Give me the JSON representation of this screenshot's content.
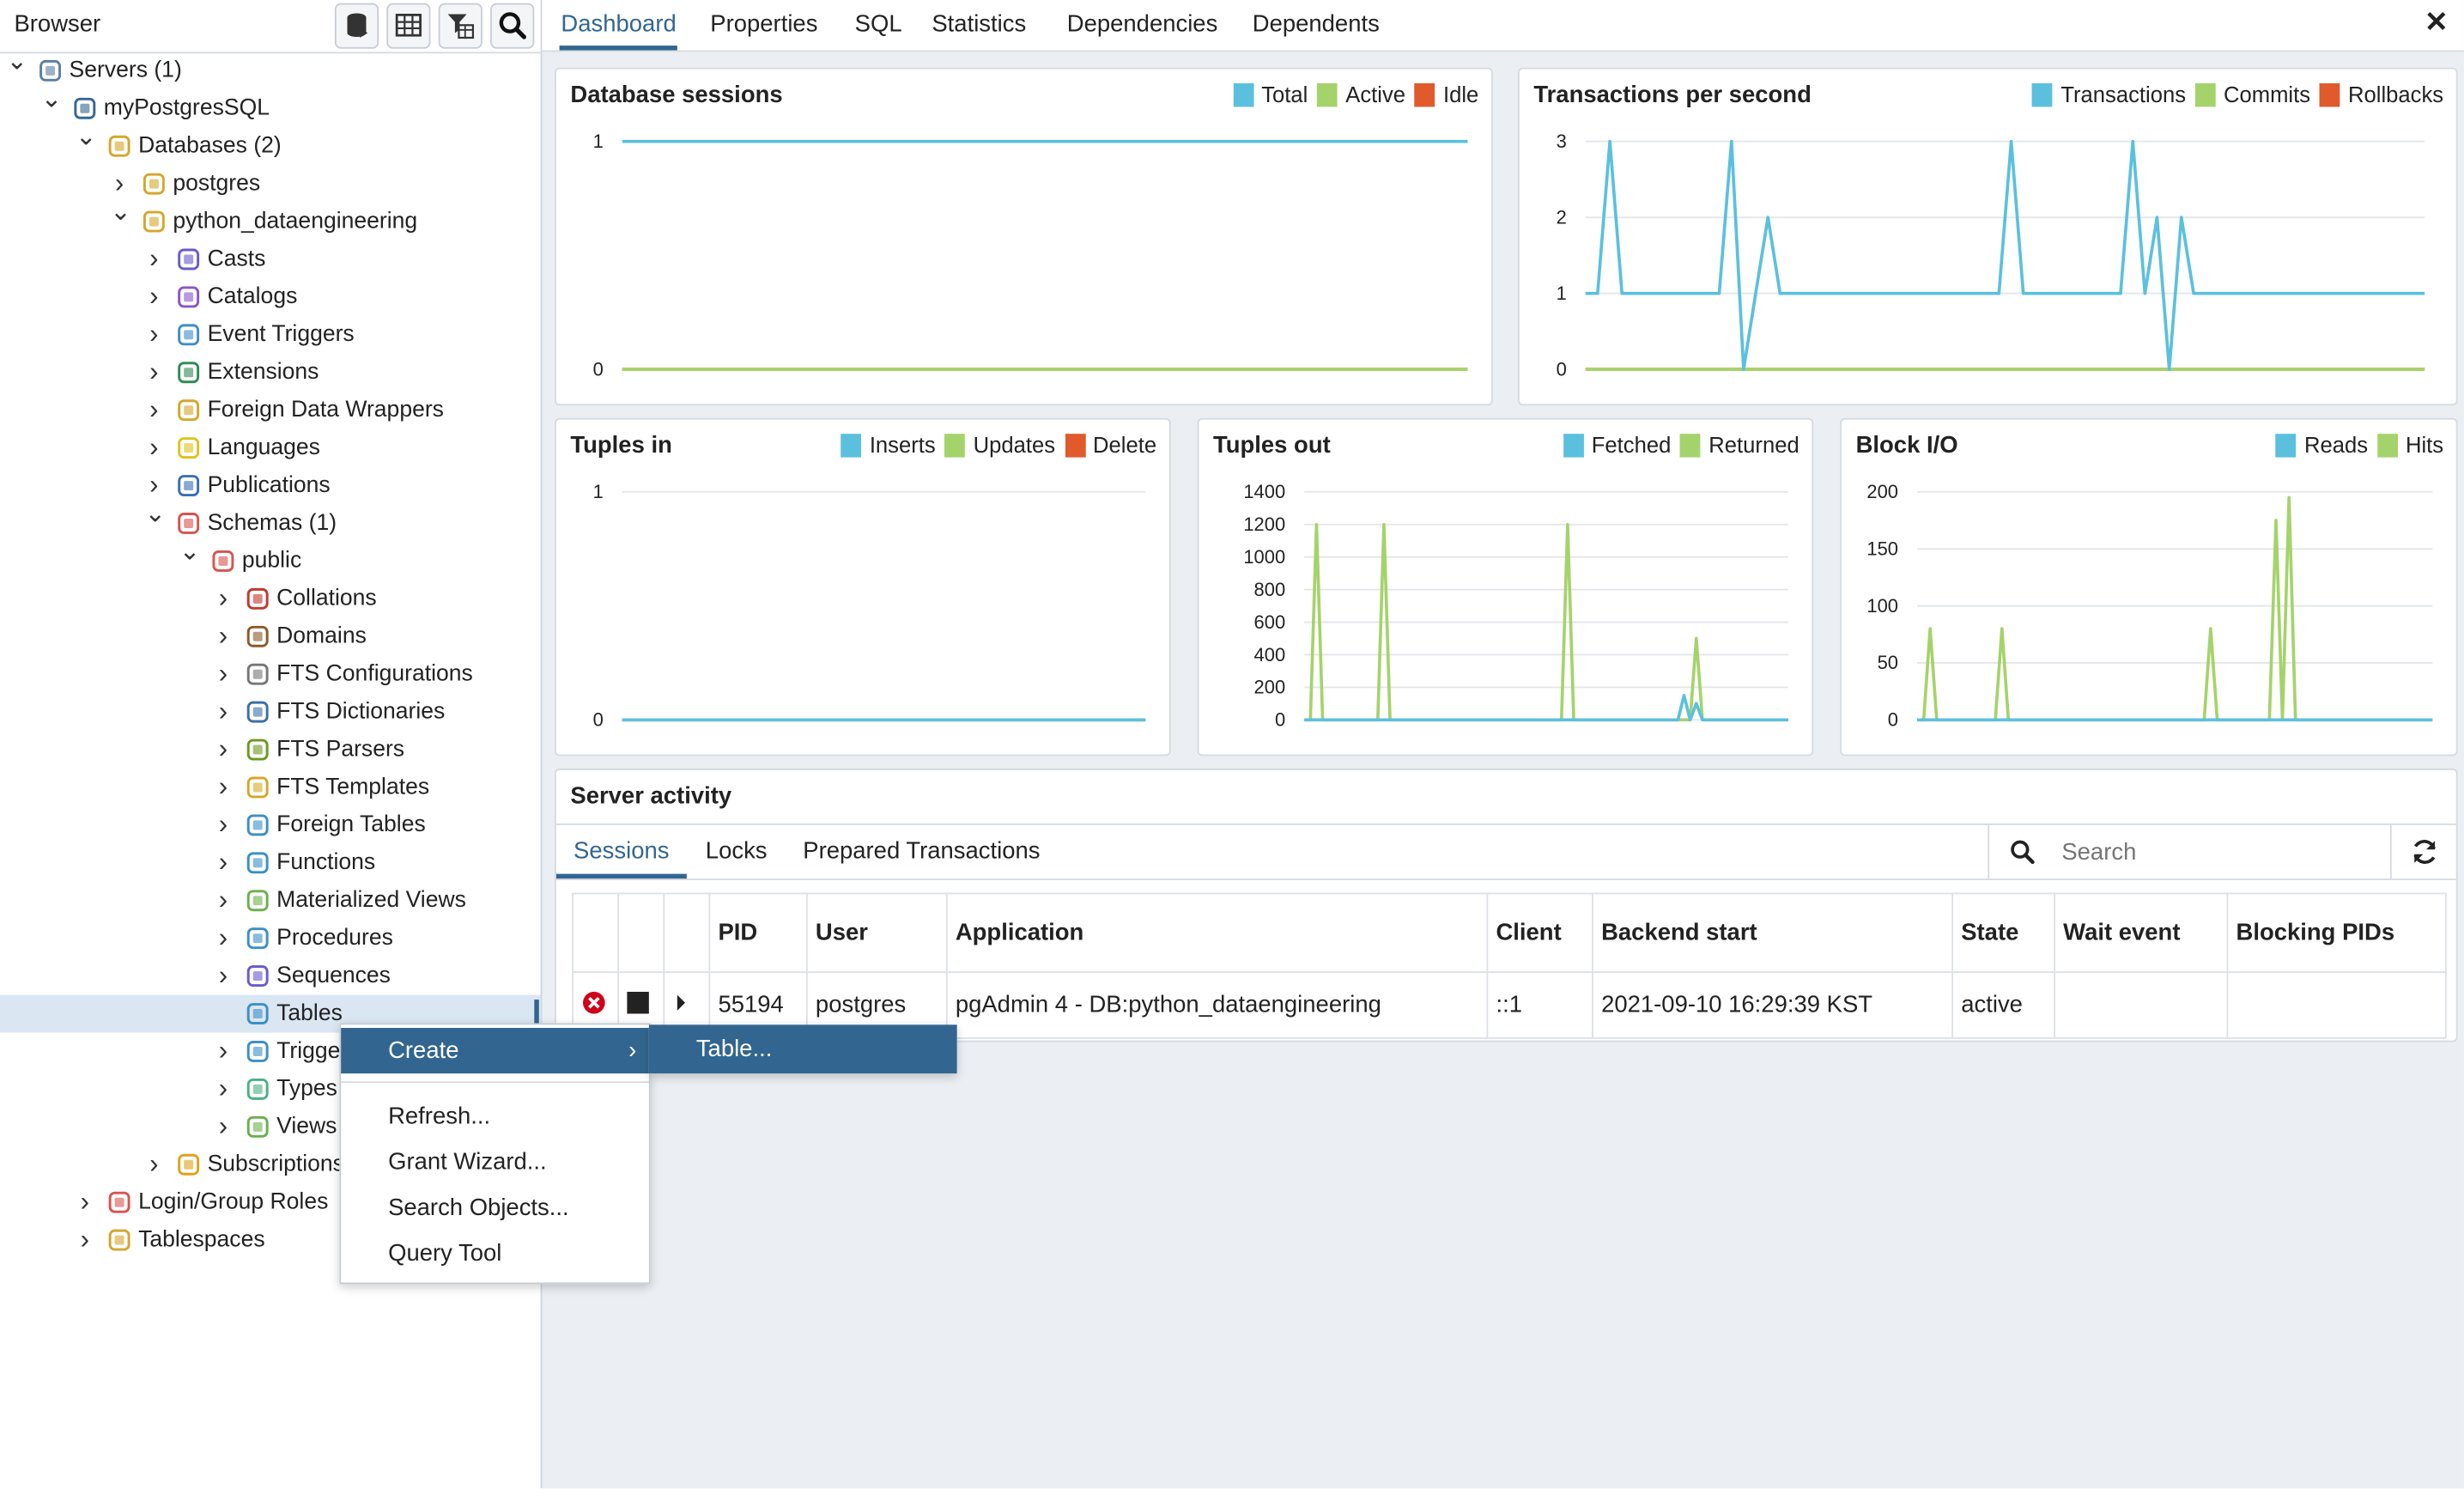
{
  "browser": {
    "title": "Browser",
    "toolbar_icons": [
      "database-icon",
      "table-icon",
      "filter-table-icon",
      "search-icon"
    ]
  },
  "tree": [
    {
      "label": "Servers (1)",
      "level": 0,
      "exp": "open",
      "icon": "servers-icon",
      "color": "#5b7fa6"
    },
    {
      "label": "myPostgresSQL",
      "level": 1,
      "exp": "open",
      "icon": "elephant-icon",
      "color": "#336791"
    },
    {
      "label": "Databases (2)",
      "level": 2,
      "exp": "open",
      "icon": "databases-icon",
      "color": "#d4a72c"
    },
    {
      "label": "postgres",
      "level": 3,
      "exp": "closed",
      "icon": "database-icon",
      "color": "#d4a72c"
    },
    {
      "label": "python_dataengineering",
      "level": 3,
      "exp": "open",
      "icon": "database-icon",
      "color": "#d4a72c"
    },
    {
      "label": "Casts",
      "level": 4,
      "exp": "closed",
      "icon": "casts-icon",
      "color": "#6a5acd"
    },
    {
      "label": "Catalogs",
      "level": 4,
      "exp": "closed",
      "icon": "catalogs-icon",
      "color": "#8a56c8"
    },
    {
      "label": "Event Triggers",
      "level": 4,
      "exp": "closed",
      "icon": "event-trigger-icon",
      "color": "#3d8fc6"
    },
    {
      "label": "Extensions",
      "level": 4,
      "exp": "closed",
      "icon": "extensions-icon",
      "color": "#2e8b57"
    },
    {
      "label": "Foreign Data Wrappers",
      "level": 4,
      "exp": "closed",
      "icon": "fdw-icon",
      "color": "#d4a72c"
    },
    {
      "label": "Languages",
      "level": 4,
      "exp": "closed",
      "icon": "languages-icon",
      "color": "#e0c21b"
    },
    {
      "label": "Publications",
      "level": 4,
      "exp": "closed",
      "icon": "publications-icon",
      "color": "#3a6fb5"
    },
    {
      "label": "Schemas (1)",
      "level": 4,
      "exp": "open",
      "icon": "schemas-icon",
      "color": "#d9534f"
    },
    {
      "label": "public",
      "level": 5,
      "exp": "open",
      "icon": "schema-icon",
      "color": "#d9534f"
    },
    {
      "label": "Collations",
      "level": 6,
      "exp": "closed",
      "icon": "collations-icon",
      "color": "#c0392b"
    },
    {
      "label": "Domains",
      "level": 6,
      "exp": "closed",
      "icon": "domains-icon",
      "color": "#8b5a2b"
    },
    {
      "label": "FTS Configurations",
      "level": 6,
      "exp": "closed",
      "icon": "fts-config-icon",
      "color": "#777777"
    },
    {
      "label": "FTS Dictionaries",
      "level": 6,
      "exp": "closed",
      "icon": "fts-dict-icon",
      "color": "#3d6fa5"
    },
    {
      "label": "FTS Parsers",
      "level": 6,
      "exp": "closed",
      "icon": "fts-parser-icon",
      "color": "#6a9a1f"
    },
    {
      "label": "FTS Templates",
      "level": 6,
      "exp": "closed",
      "icon": "fts-template-icon",
      "color": "#d4a72c"
    },
    {
      "label": "Foreign Tables",
      "level": 6,
      "exp": "closed",
      "icon": "foreign-table-icon",
      "color": "#3d8fc6"
    },
    {
      "label": "Functions",
      "level": 6,
      "exp": "closed",
      "icon": "functions-icon",
      "color": "#3d8fc6"
    },
    {
      "label": "Materialized Views",
      "level": 6,
      "exp": "closed",
      "icon": "mat-view-icon",
      "color": "#6ab04c"
    },
    {
      "label": "Procedures",
      "level": 6,
      "exp": "closed",
      "icon": "procedures-icon",
      "color": "#3d8fc6"
    },
    {
      "label": "Sequences",
      "level": 6,
      "exp": "closed",
      "icon": "sequences-icon",
      "color": "#6a5acd"
    },
    {
      "label": "Tables",
      "level": 6,
      "exp": "none",
      "icon": "tables-icon",
      "color": "#3d8fc6",
      "selected": true
    },
    {
      "label": "Trigger Functions",
      "level": 6,
      "exp": "closed",
      "icon": "trigger-functions-icon",
      "color": "#3d8fc6"
    },
    {
      "label": "Types",
      "level": 6,
      "exp": "closed",
      "icon": "types-icon",
      "color": "#4caf84"
    },
    {
      "label": "Views",
      "level": 6,
      "exp": "closed",
      "icon": "views-icon",
      "color": "#6ab04c"
    },
    {
      "label": "Subscriptions",
      "level": 4,
      "exp": "closed",
      "icon": "subscriptions-icon",
      "color": "#e0a21b"
    },
    {
      "label": "Login/Group Roles",
      "level": 2,
      "exp": "closed",
      "icon": "roles-icon",
      "color": "#d9534f"
    },
    {
      "label": "Tablespaces",
      "level": 2,
      "exp": "closed",
      "icon": "tablespaces-icon",
      "color": "#d4a72c"
    }
  ],
  "tabs": [
    "Dashboard",
    "Properties",
    "SQL",
    "Statistics",
    "Dependencies",
    "Dependents"
  ],
  "active_tab": "Dashboard",
  "colors": {
    "blue": "#5bc0de",
    "green": "#a5d36b",
    "orange": "#e05a2b",
    "accent": "#326690"
  },
  "chart_data": [
    {
      "type": "line",
      "title": "Database sessions",
      "ylim": [
        0,
        1
      ],
      "yticks": [
        "0",
        "1"
      ],
      "series": [
        {
          "name": "Total",
          "values": [
            1,
            1,
            1,
            1,
            1,
            1,
            1,
            1,
            1,
            1,
            1,
            1,
            1,
            1,
            1,
            1,
            1,
            1,
            1,
            1
          ]
        },
        {
          "name": "Active",
          "values": [
            0,
            0,
            0,
            0,
            0,
            0,
            0,
            0,
            0,
            0,
            0,
            0,
            0,
            0,
            0,
            0,
            0,
            0,
            0,
            0
          ]
        },
        {
          "name": "Idle",
          "values": [
            0,
            0,
            0,
            0,
            0,
            0,
            0,
            0,
            0,
            0,
            0,
            0,
            0,
            0,
            0,
            0,
            0,
            0,
            0,
            0
          ]
        }
      ]
    },
    {
      "type": "line",
      "title": "Transactions per second",
      "ylim": [
        0,
        3
      ],
      "yticks": [
        "0",
        "1",
        "2",
        "3"
      ],
      "series": [
        {
          "name": "Transactions",
          "values": [
            1,
            1,
            3,
            1,
            1,
            1,
            1,
            1,
            1,
            1,
            1,
            1,
            3,
            0,
            1,
            2,
            1,
            1,
            1,
            1,
            1,
            1,
            1,
            1,
            1,
            1,
            1,
            1,
            1,
            1,
            1,
            1,
            1,
            1,
            1,
            3,
            1,
            1,
            1,
            1,
            1,
            1,
            1,
            1,
            1,
            3,
            1,
            2,
            0,
            2,
            1,
            1,
            1,
            1,
            1,
            1,
            1,
            1,
            1,
            1,
            1,
            1,
            1,
            1,
            1,
            1,
            1,
            1,
            1,
            1
          ]
        },
        {
          "name": "Commits",
          "values": [
            0,
            0,
            0,
            0,
            0,
            0,
            0,
            0,
            0,
            0,
            0,
            0,
            0,
            0,
            0,
            0,
            0,
            0,
            0,
            0,
            0,
            0,
            0,
            0,
            0,
            0,
            0,
            0,
            0,
            0,
            0,
            0,
            0,
            0,
            0,
            0,
            0,
            0,
            0,
            0,
            0,
            0,
            0,
            0,
            0,
            0,
            0,
            0,
            0,
            0,
            0,
            0,
            0,
            0,
            0,
            0,
            0,
            0,
            0,
            0,
            0,
            0,
            0,
            0,
            0,
            0,
            0,
            0,
            0,
            0
          ]
        },
        {
          "name": "Rollbacks",
          "values": [
            0,
            0,
            0,
            0,
            0,
            0,
            0,
            0,
            0,
            0,
            0,
            0,
            0,
            0,
            0,
            0,
            0,
            0,
            0,
            0,
            0,
            0,
            0,
            0,
            0,
            0,
            0,
            0,
            0,
            0,
            0,
            0,
            0,
            0,
            0,
            0,
            0,
            0,
            0,
            0,
            0,
            0,
            0,
            0,
            0,
            0,
            0,
            0,
            0,
            0,
            0,
            0,
            0,
            0,
            0,
            0,
            0,
            0,
            0,
            0,
            0,
            0,
            0,
            0,
            0,
            0,
            0,
            0,
            0,
            0
          ]
        }
      ]
    },
    {
      "type": "line",
      "title": "Tuples in",
      "ylim": [
        0,
        1
      ],
      "yticks": [
        "0",
        "1"
      ],
      "series": [
        {
          "name": "Inserts",
          "values": [
            0,
            0,
            0,
            0,
            0,
            0,
            0,
            0,
            0,
            0,
            0,
            0,
            0,
            0,
            0,
            0,
            0,
            0,
            0,
            0
          ]
        },
        {
          "name": "Updates",
          "values": [
            0,
            0,
            0,
            0,
            0,
            0,
            0,
            0,
            0,
            0,
            0,
            0,
            0,
            0,
            0,
            0,
            0,
            0,
            0,
            0
          ]
        },
        {
          "name": "Delete",
          "values": [
            0,
            0,
            0,
            0,
            0,
            0,
            0,
            0,
            0,
            0,
            0,
            0,
            0,
            0,
            0,
            0,
            0,
            0,
            0,
            0
          ]
        }
      ]
    },
    {
      "type": "line",
      "title": "Tuples out",
      "ylim": [
        0,
        1400
      ],
      "yticks": [
        "0",
        "200",
        "400",
        "600",
        "800",
        "1000",
        "1200",
        "1400"
      ],
      "series": [
        {
          "name": "Fetched",
          "values": [
            0,
            0,
            0,
            0,
            0,
            0,
            0,
            0,
            0,
            0,
            0,
            0,
            0,
            0,
            0,
            0,
            0,
            0,
            0,
            0,
            0,
            0,
            0,
            0,
            0,
            0,
            0,
            0,
            0,
            0,
            0,
            0,
            0,
            0,
            0,
            0,
            0,
            0,
            0,
            0,
            0,
            0,
            0,
            0,
            0,
            0,
            0,
            0,
            0,
            0,
            0,
            0,
            0,
            0,
            0,
            0,
            0,
            0,
            0,
            0,
            0,
            0,
            150,
            0,
            100,
            0,
            0,
            0,
            0,
            0,
            0,
            0,
            0,
            0,
            0,
            0,
            0,
            0,
            0,
            0
          ]
        },
        {
          "name": "Returned",
          "values": [
            0,
            0,
            1200,
            0,
            0,
            0,
            0,
            0,
            0,
            0,
            0,
            0,
            0,
            1200,
            0,
            0,
            0,
            0,
            0,
            0,
            0,
            0,
            0,
            0,
            0,
            0,
            0,
            0,
            0,
            0,
            0,
            0,
            0,
            0,
            0,
            0,
            0,
            0,
            0,
            0,
            0,
            0,
            0,
            1200,
            0,
            0,
            0,
            0,
            0,
            0,
            0,
            0,
            0,
            0,
            0,
            0,
            0,
            0,
            0,
            0,
            0,
            0,
            0,
            0,
            500,
            0,
            0,
            0,
            0,
            0,
            0,
            0,
            0,
            0,
            0,
            0,
            0,
            0,
            0,
            0
          ]
        }
      ]
    },
    {
      "type": "line",
      "title": "Block I/O",
      "ylim": [
        0,
        200
      ],
      "yticks": [
        "0",
        "50",
        "100",
        "150",
        "200"
      ],
      "series": [
        {
          "name": "Reads",
          "values": [
            0,
            0,
            0,
            0,
            0,
            0,
            0,
            0,
            0,
            0,
            0,
            0,
            0,
            0,
            0,
            0,
            0,
            0,
            0,
            0,
            0,
            0,
            0,
            0,
            0,
            0,
            0,
            0,
            0,
            0,
            0,
            0,
            0,
            0,
            0,
            0,
            0,
            0,
            0,
            0,
            0,
            0,
            0,
            0,
            0,
            0,
            0,
            0,
            0,
            0,
            0,
            0,
            0,
            0,
            0,
            0,
            0,
            0,
            0,
            0,
            0,
            0,
            0,
            0,
            0,
            0,
            0,
            0,
            0,
            0,
            0,
            0,
            0,
            0,
            0,
            0,
            0,
            0,
            0,
            0
          ]
        },
        {
          "name": "Hits",
          "values": [
            0,
            0,
            80,
            0,
            0,
            0,
            0,
            0,
            0,
            0,
            0,
            0,
            0,
            80,
            0,
            0,
            0,
            0,
            0,
            0,
            0,
            0,
            0,
            0,
            0,
            0,
            0,
            0,
            0,
            0,
            0,
            0,
            0,
            0,
            0,
            0,
            0,
            0,
            0,
            0,
            0,
            0,
            0,
            0,
            0,
            80,
            0,
            0,
            0,
            0,
            0,
            0,
            0,
            0,
            0,
            175,
            0,
            195,
            0,
            0,
            0,
            0,
            0,
            0,
            0,
            0,
            0,
            0,
            0,
            0,
            0,
            0,
            0,
            0,
            0,
            0,
            0,
            0,
            0,
            0
          ]
        }
      ]
    }
  ],
  "server_activity": {
    "title": "Server activity",
    "tabs": [
      "Sessions",
      "Locks",
      "Prepared Transactions"
    ],
    "search_placeholder": "Search",
    "columns": [
      "PID",
      "User",
      "Application",
      "Client",
      "Backend start",
      "State",
      "Wait event",
      "Blocking PIDs"
    ],
    "rows": [
      {
        "pid": "55194",
        "user": "postgres",
        "application": "pgAdmin 4 - DB:python_dataengineering",
        "client": "::1",
        "backend_start": "2021-09-10 16:29:39 KST",
        "state": "active",
        "wait_event": "",
        "blocking": ""
      }
    ]
  },
  "context_menu": {
    "items": [
      "Create",
      "Refresh...",
      "Grant Wizard...",
      "Search Objects...",
      "Query Tool"
    ],
    "submenu": [
      "Table..."
    ]
  }
}
